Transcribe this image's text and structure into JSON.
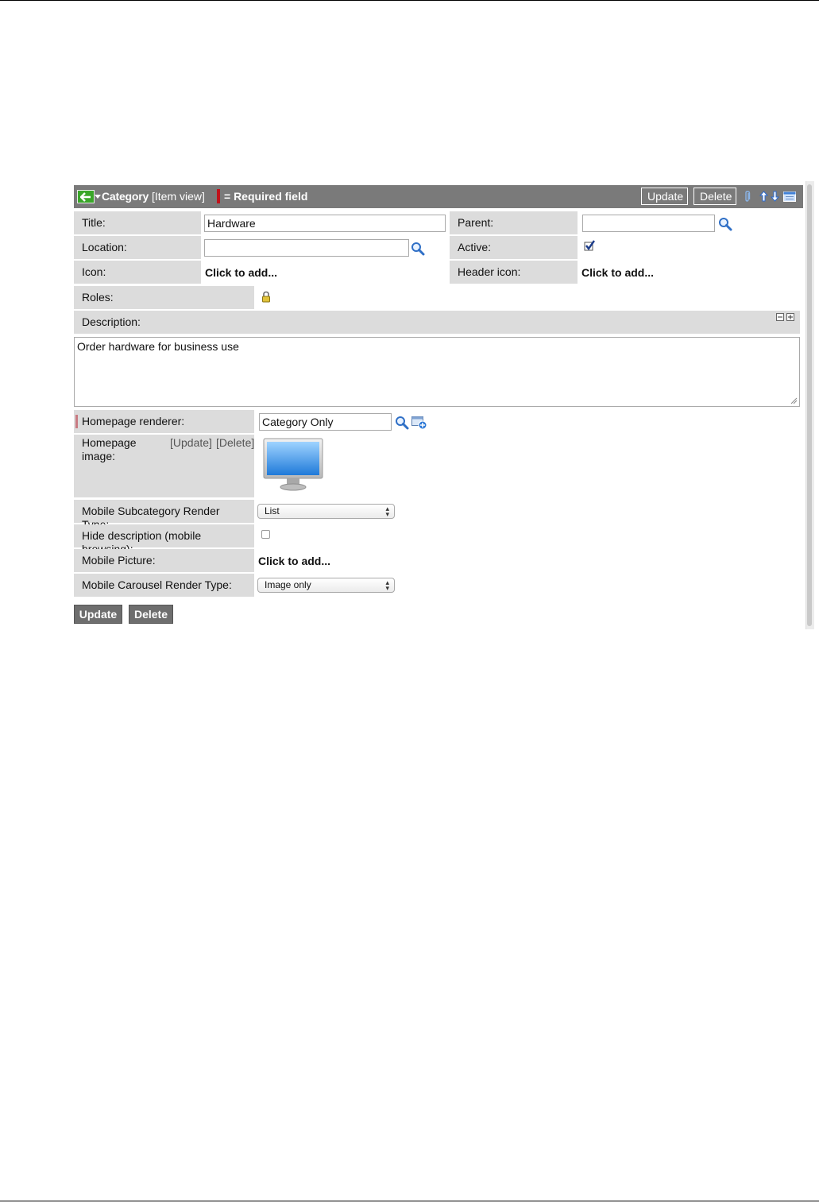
{
  "header": {
    "title": "Category",
    "view_label": "[Item view]",
    "required_legend": "= Required field",
    "update_label": "Update",
    "delete_label": "Delete",
    "background_color": "#7a7a7a",
    "required_color": "#c0121b"
  },
  "fields": {
    "title_label": "Title:",
    "title_value": "Hardware",
    "parent_label": "Parent:",
    "parent_value": "",
    "location_label": "Location:",
    "location_value": "",
    "active_label": "Active:",
    "active_checked": true,
    "icon_label": "Icon:",
    "icon_value": "Click to add...",
    "header_icon_label": "Header icon:",
    "header_icon_value": "Click to add...",
    "roles_label": "Roles:",
    "description_label": "Description:",
    "description_value": "Order hardware for business use",
    "homepage_renderer_label": "Homepage renderer:",
    "homepage_renderer_value": "Category Only",
    "homepage_image_label": "Homepage image:",
    "homepage_image_update": "[Update]",
    "homepage_image_delete": "[Delete]",
    "mobile_subcategory_label": "Mobile Subcategory Render Type:",
    "mobile_subcategory_value": "List",
    "hide_description_label": "Hide description (mobile browsing):",
    "hide_description_checked": false,
    "mobile_picture_label": "Mobile Picture:",
    "mobile_picture_value": "Click to add...",
    "mobile_carousel_label": "Mobile Carousel Render Type:",
    "mobile_carousel_value": "Image only"
  },
  "footer": {
    "update_label": "Update",
    "delete_label": "Delete"
  },
  "icons": [
    "back-arrow-icon",
    "menu-caret-icon",
    "attachment-icon",
    "move-up-icon",
    "move-down-icon",
    "form-settings-icon",
    "search-icon",
    "checkbox-checked-icon",
    "lock-icon",
    "collapse-icon",
    "expand-icon",
    "reference-add-icon",
    "monitor-image"
  ]
}
